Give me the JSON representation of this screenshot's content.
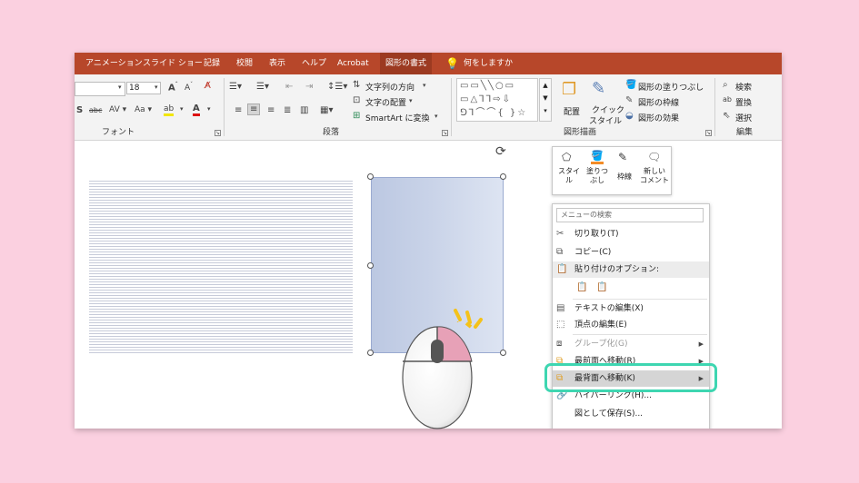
{
  "tabs": [
    "アニメーション",
    "スライド ショー",
    "記録",
    "校閲",
    "表示",
    "ヘルプ",
    "Acrobat",
    "図形の書式"
  ],
  "tell_me": "何をしますか",
  "ribbon": {
    "font_size": "18",
    "groups": {
      "font": "フォント",
      "paragraph": "段落",
      "drawing": "図形描画",
      "editing": "編集"
    },
    "text_direction": "文字列の方向",
    "text_align": "文字の配置",
    "smartart": "SmartArt に変換",
    "arrange": "配置",
    "quick_style_1": "クイック",
    "quick_style_2": "スタイル",
    "shape_fill": "図形の塗りつぶし",
    "shape_outline": "図形の枠線",
    "shape_effects": "図形の効果",
    "find": "検索",
    "replace": "置換",
    "select": "選択"
  },
  "mini_toolbar": {
    "style_1": "スタイ",
    "style_2": "ル",
    "fill_1": "塗りつ",
    "fill_2": "ぶし",
    "outline": "枠線",
    "comment_1": "新しい",
    "comment_2": "コメント"
  },
  "context_menu": {
    "search_placeholder": "メニューの検索",
    "cut": "切り取り(T)",
    "copy": "コピー(C)",
    "paste_options": "貼り付けのオプション:",
    "edit_text": "テキストの編集(X)",
    "edit_points": "頂点の編集(E)",
    "group": "グループ化(G)",
    "bring_front": "最前面へ移動(R)",
    "send_back": "最背面へ移動(K)",
    "hyperlink": "ハイパーリンク(H)...",
    "save_as_picture": "図として保存(S)..."
  },
  "colors": {
    "accent": "#b7472a",
    "highlight": "#3ed6b1",
    "background": "#fbd0e0"
  }
}
